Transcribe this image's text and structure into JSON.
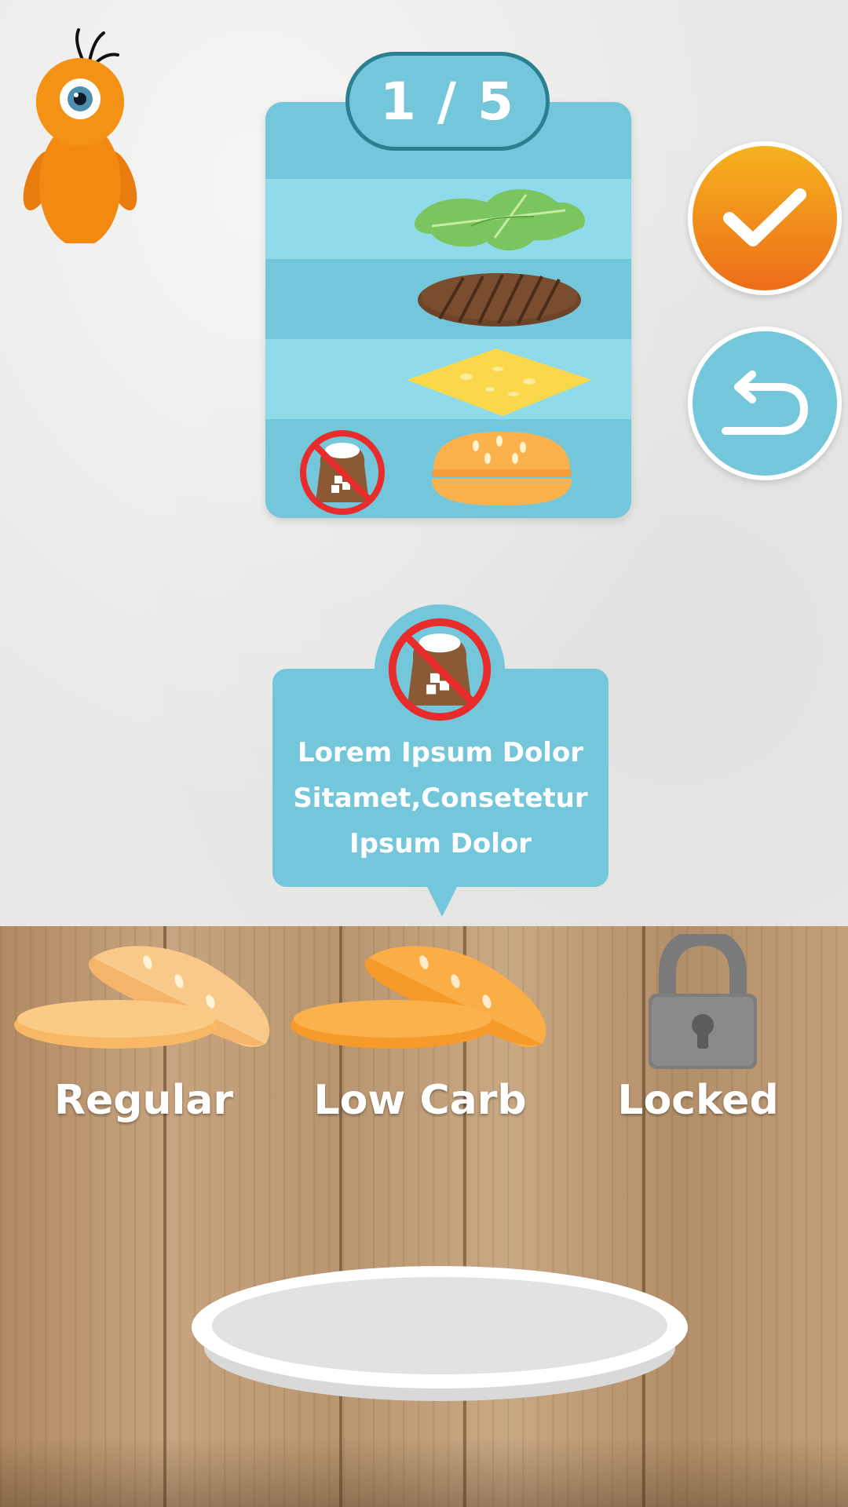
{
  "level": {
    "counter_text": "1 / 5"
  },
  "recipe": {
    "layers": [
      "lettuce-icon",
      "patty-icon",
      "cheese-icon",
      "bun-icon"
    ],
    "restriction_icon": "no-sugar-icon"
  },
  "actions": {
    "confirm_icon": "checkmark-icon",
    "undo_icon": "undo-arrow-icon"
  },
  "info_bubble": {
    "icon": "no-sugar-icon",
    "lines": [
      "Lorem Ipsum Dolor",
      "Sitamet,Consetetur",
      "Ipsum Dolor"
    ]
  },
  "bun_options": [
    {
      "label": "Regular",
      "icon": "regular-bun-icon",
      "locked": false
    },
    {
      "label": "Low Carb",
      "icon": "low-carb-bun-icon",
      "locked": false
    },
    {
      "label": "Locked",
      "icon": "lock-icon",
      "locked": true
    }
  ],
  "colors": {
    "card_blue": "#74c7da",
    "card_light_blue": "#8fdbe9",
    "accent_orange": "#ec6d19",
    "pill_border": "#2a7f90"
  }
}
